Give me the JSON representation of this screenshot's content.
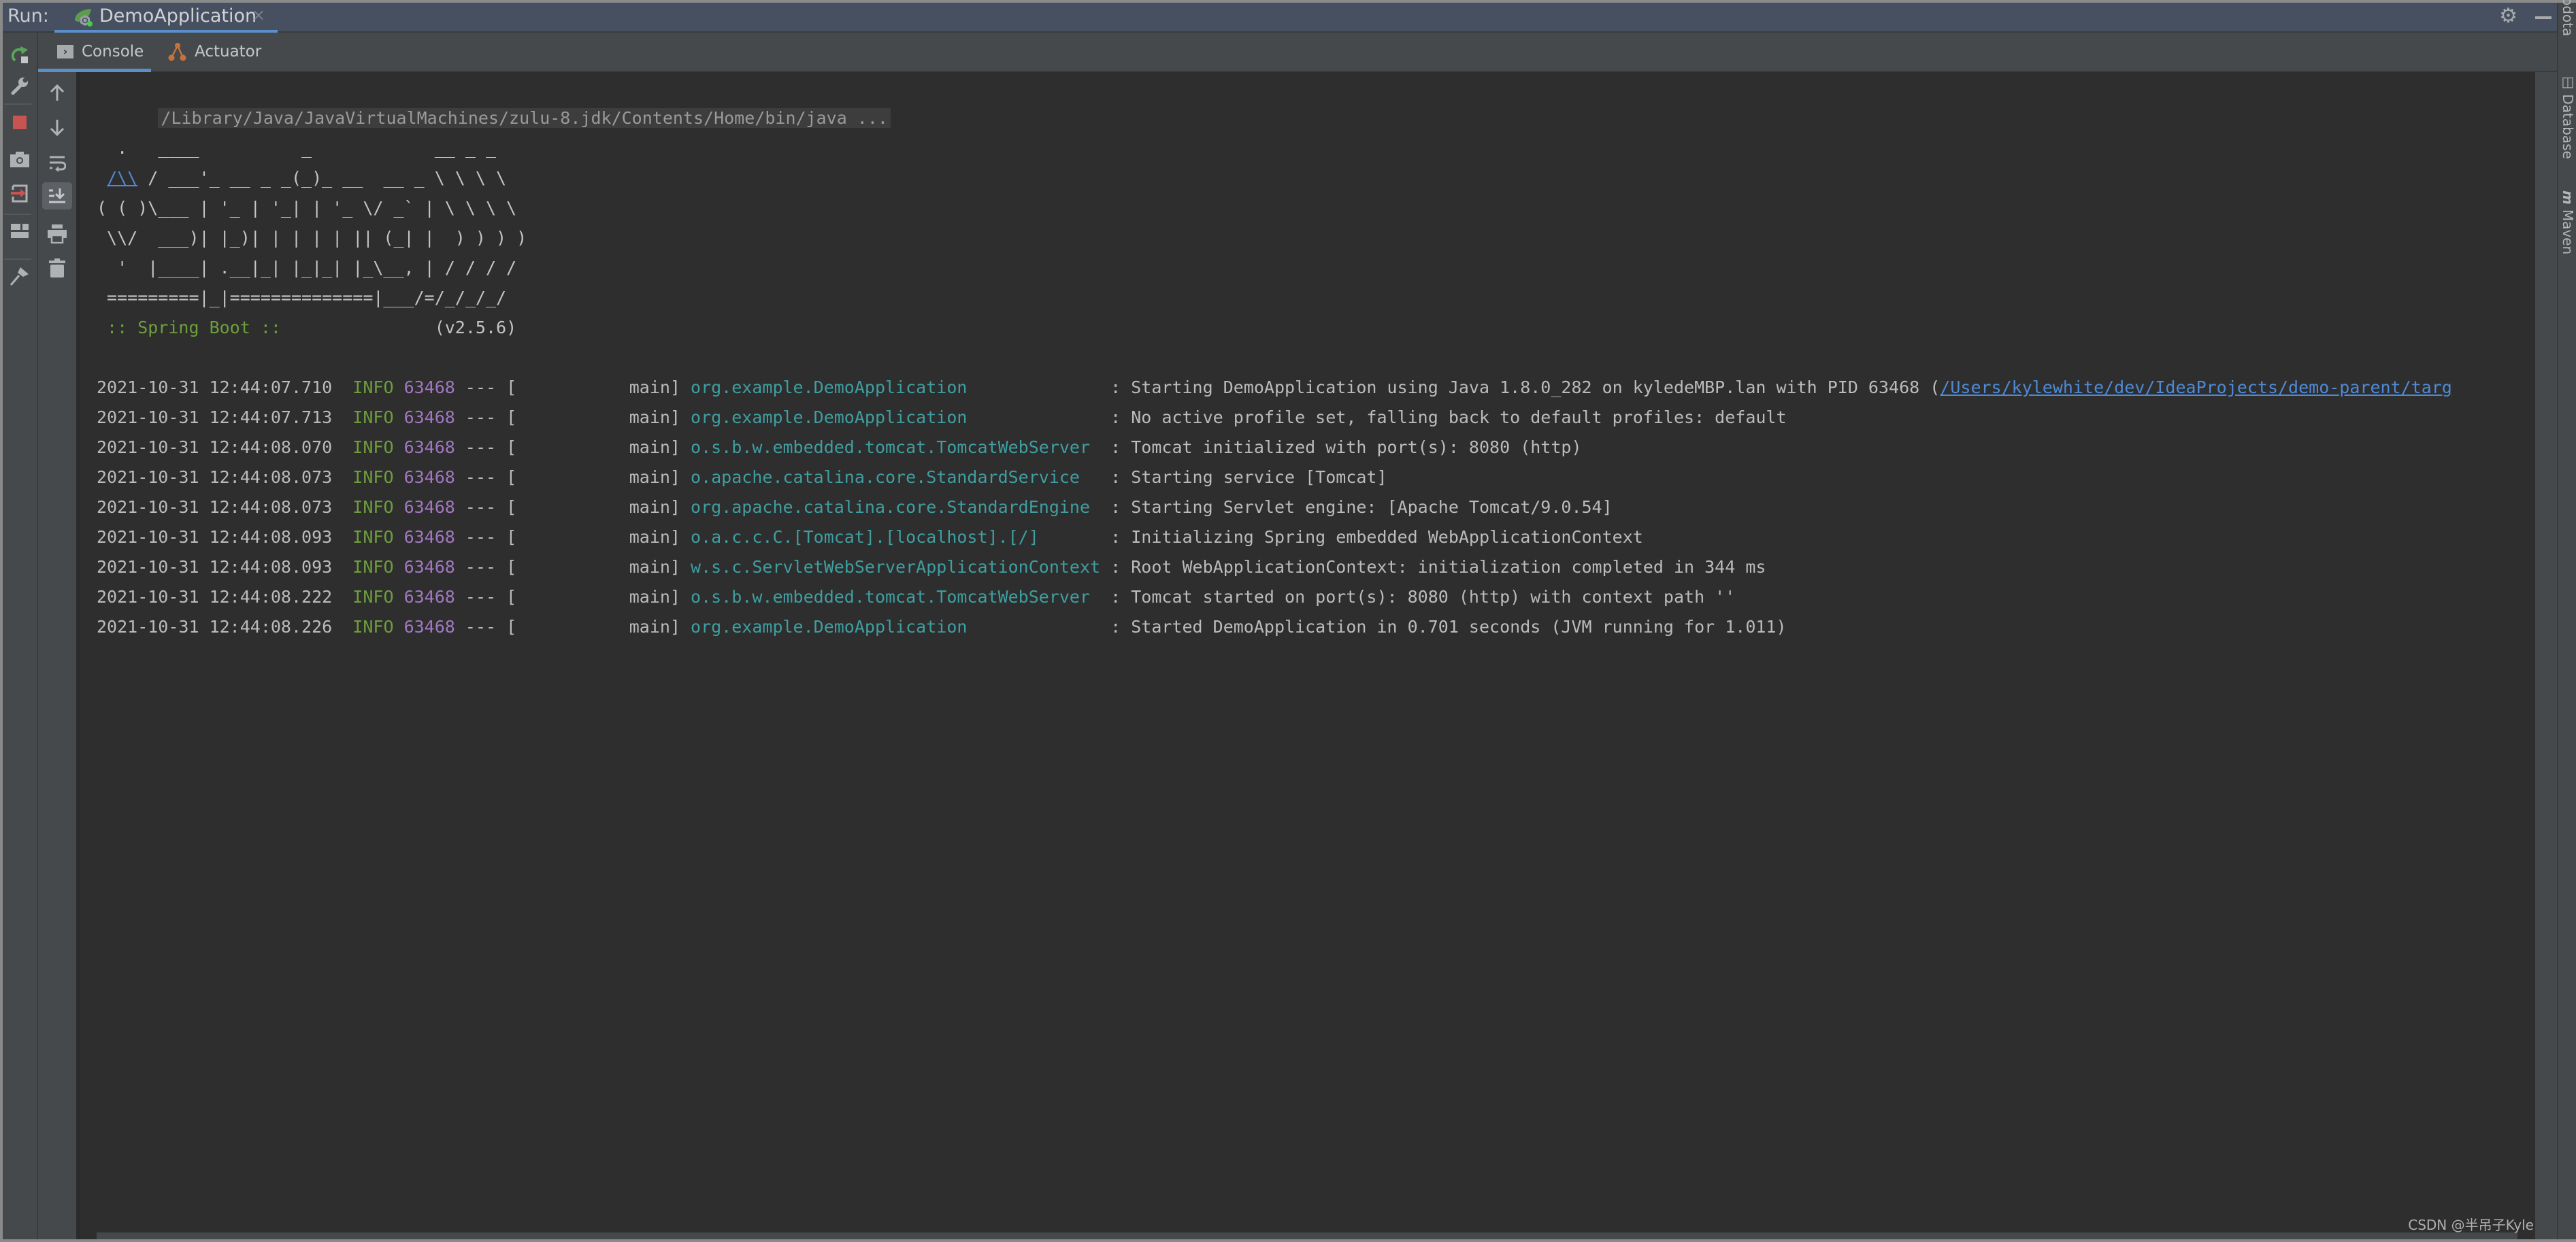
{
  "titlebar": {
    "run_label": "Run:",
    "run_tab": {
      "label": "DemoApplication",
      "close": "×",
      "icon": "spring-boot-icon"
    },
    "settings_icon": "gear-icon",
    "minimize_icon": "minimize-icon"
  },
  "tabs": [
    {
      "label": "Console",
      "icon": "console-icon",
      "active": true
    },
    {
      "label": "Actuator",
      "icon": "actuator-icon",
      "active": false
    }
  ],
  "left_toolbar": [
    "rerun-icon",
    "wrench-icon",
    "stop-icon",
    "camera-icon",
    "exit-icon",
    "layout-icon",
    "pin-icon"
  ],
  "console_toolbar": [
    "up-arrow-icon",
    "down-arrow-icon",
    "soft-wrap-icon",
    "scroll-to-end-icon",
    "print-icon",
    "trash-icon"
  ],
  "right_stripe": [
    "odota",
    "Database",
    "Maven"
  ],
  "console": {
    "command": "/Library/Java/JavaVirtualMachines/zulu-8.jdk/Contents/Home/bin/java ...",
    "banner": {
      "line1": "  .   ____          _            __ _ _",
      "line2_link": "/\\\\",
      "line2_rest": " / ___'_ __ _ _(_)_ __  __ _ \\ \\ \\ \\",
      "line3": "( ( )\\___ | '_ | '_| | '_ \\/ _` | \\ \\ \\ \\",
      "line4": " \\\\/  ___)| |_)| | | | | || (_| |  ) ) ) )",
      "line5": "  '  |____| .__|_| |_|_| |_\\__, | / / / /",
      "line6": " =========|_|==============|___/=/_/_/_/",
      "spring_label": " :: Spring Boot ::",
      "version": "               (v2.5.6)"
    },
    "logs": [
      {
        "ts": "2021-10-31 12:44:07.710",
        "level": "INFO",
        "pid": "63468",
        "thread": " --- [           main] ",
        "logger": "org.example.DemoApplication              ",
        "msg": ": Starting DemoApplication using Java 1.8.0_282 on kyledeMBP.lan with PID 63468 (",
        "link": "/Users/kylewhite/dev/IdeaProjects/demo-parent/targ"
      },
      {
        "ts": "2021-10-31 12:44:07.713",
        "level": "INFO",
        "pid": "63468",
        "thread": " --- [           main] ",
        "logger": "org.example.DemoApplication              ",
        "msg": ": No active profile set, falling back to default profiles: default"
      },
      {
        "ts": "2021-10-31 12:44:08.070",
        "level": "INFO",
        "pid": "63468",
        "thread": " --- [           main] ",
        "logger": "o.s.b.w.embedded.tomcat.TomcatWebServer  ",
        "msg": ": Tomcat initialized with port(s): 8080 (http)"
      },
      {
        "ts": "2021-10-31 12:44:08.073",
        "level": "INFO",
        "pid": "63468",
        "thread": " --- [           main] ",
        "logger": "o.apache.catalina.core.StandardService   ",
        "msg": ": Starting service [Tomcat]"
      },
      {
        "ts": "2021-10-31 12:44:08.073",
        "level": "INFO",
        "pid": "63468",
        "thread": " --- [           main] ",
        "logger": "org.apache.catalina.core.StandardEngine  ",
        "msg": ": Starting Servlet engine: [Apache Tomcat/9.0.54]"
      },
      {
        "ts": "2021-10-31 12:44:08.093",
        "level": "INFO",
        "pid": "63468",
        "thread": " --- [           main] ",
        "logger": "o.a.c.c.C.[Tomcat].[localhost].[/]       ",
        "msg": ": Initializing Spring embedded WebApplicationContext"
      },
      {
        "ts": "2021-10-31 12:44:08.093",
        "level": "INFO",
        "pid": "63468",
        "thread": " --- [           main] ",
        "logger": "w.s.c.ServletWebServerApplicationContext ",
        "msg": ": Root WebApplicationContext: initialization completed in 344 ms"
      },
      {
        "ts": "2021-10-31 12:44:08.222",
        "level": "INFO",
        "pid": "63468",
        "thread": " --- [           main] ",
        "logger": "o.s.b.w.embedded.tomcat.TomcatWebServer  ",
        "msg": ": Tomcat started on port(s): 8080 (http) with context path ''"
      },
      {
        "ts": "2021-10-31 12:44:08.226",
        "level": "INFO",
        "pid": "63468",
        "thread": " --- [           main] ",
        "logger": "org.example.DemoApplication              ",
        "msg": ": Started DemoApplication in 0.701 seconds (JVM running for 1.011)"
      }
    ]
  },
  "watermark": "CSDN @半吊子Kyle",
  "colors": {
    "accent": "#5b8fcb",
    "info_level": "#6e9e3c",
    "pid": "#a277c2",
    "logger": "#3f9ea0",
    "link": "#4e8ad6",
    "stop": "#c75450",
    "rerun": "#59a35a"
  }
}
